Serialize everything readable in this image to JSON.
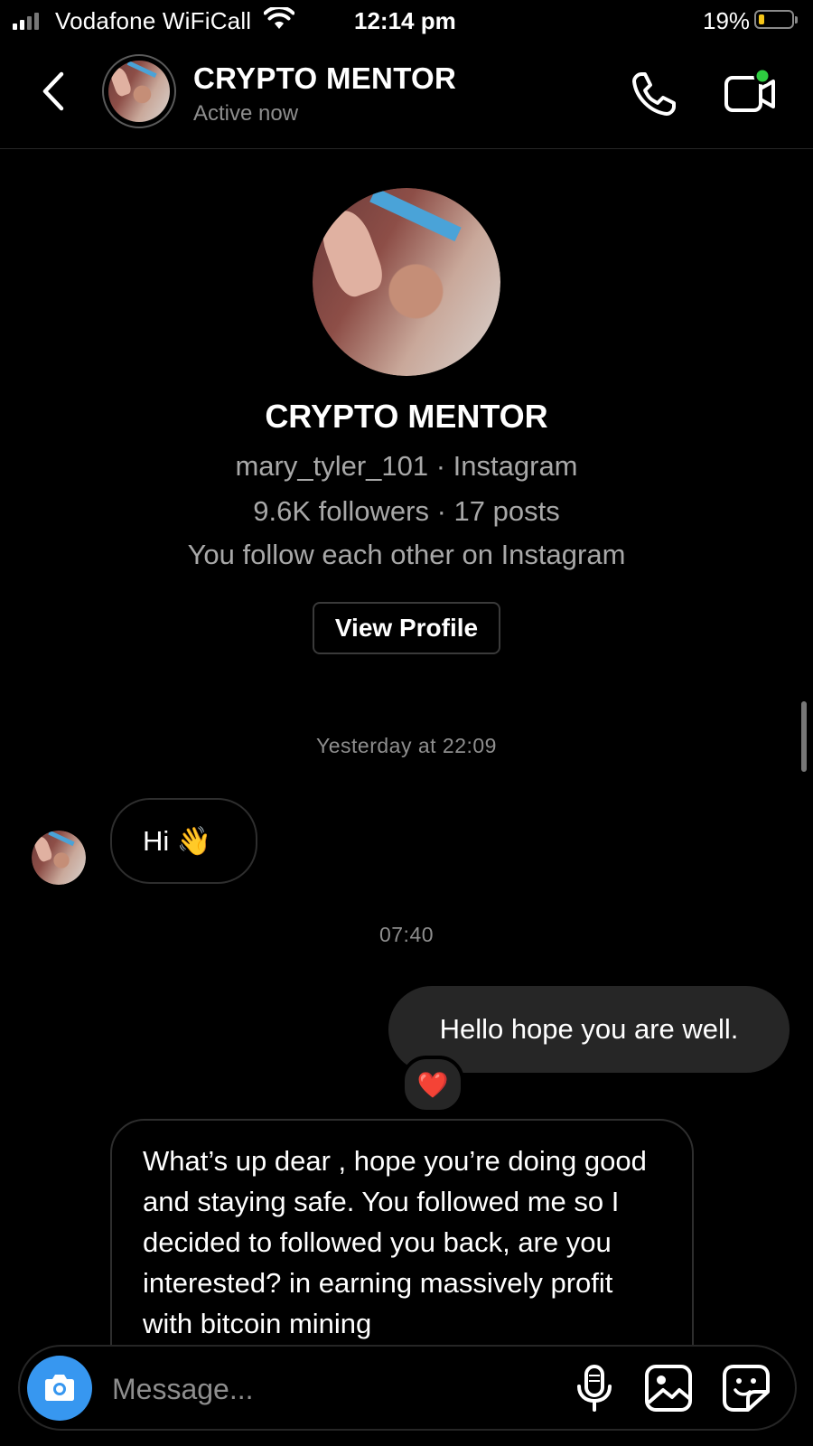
{
  "status_bar": {
    "carrier": "Vodafone WiFiCall",
    "time": "12:14 pm",
    "battery_percent": "19%",
    "battery_level": 0.19,
    "battery_color": "#f5c518"
  },
  "header": {
    "back_icon": "chevron-left-icon",
    "name": "CRYPTO MENTOR",
    "status": "Active now",
    "call_icon": "phone-icon",
    "video_icon": "video-camera-icon",
    "online_color": "#2ecc40"
  },
  "profile": {
    "name": "CRYPTO MENTOR",
    "handle_line": "mary_tyler_101 · Instagram",
    "stats_line": "9.6K followers · 17 posts",
    "mutual_line": "You follow each other on Instagram",
    "view_profile_label": "View Profile"
  },
  "conversation": {
    "timestamps": [
      "Yesterday at 22:09",
      "07:40"
    ],
    "messages": [
      {
        "sender": "them",
        "text": "Hi 👋"
      },
      {
        "sender": "me",
        "text": "Hello hope you are well.",
        "reaction": "❤️"
      },
      {
        "sender": "them",
        "text": "What’s up dear , hope you’re doing good and staying safe. You followed me so I decided to followed you back, are you interested? in earning massively profit with bitcoin mining"
      }
    ]
  },
  "composer": {
    "placeholder": "Message...",
    "camera_icon": "camera-icon",
    "mic_icon": "microphone-icon",
    "gallery_icon": "image-icon",
    "sticker_icon": "sticker-icon",
    "accent_color": "#3797f0"
  }
}
